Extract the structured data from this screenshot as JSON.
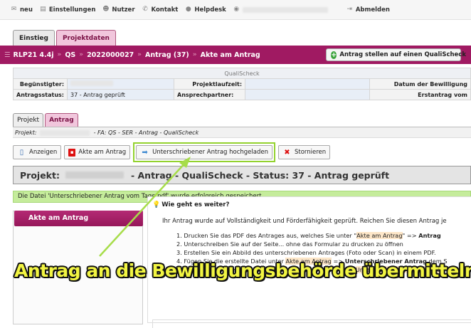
{
  "topbar": {
    "items": [
      {
        "icon": "envelope-icon",
        "label": "neu"
      },
      {
        "icon": "settings-icon",
        "label": "Einstellungen"
      },
      {
        "icon": "users-icon",
        "label": "Nutzer"
      },
      {
        "icon": "phone-icon",
        "label": "Kontakt"
      },
      {
        "icon": "chat-icon",
        "label": "Helpdesk"
      }
    ],
    "logout": "Abmelden"
  },
  "main_tabs": [
    {
      "label": "Einstieg",
      "active": false
    },
    {
      "label": "Projektdaten",
      "active": true
    }
  ],
  "breadcrumb": {
    "program": "RLP21 4.4j",
    "type": "QS",
    "number": "2022000027",
    "antrag": "Antrag (37)",
    "page": "Akte am Antrag",
    "action_button": "Antrag stellen auf einen QualiScheck"
  },
  "info": {
    "header": "QualiScheck",
    "beguenstigter_label": "Begünstigter:",
    "laufzeit_label": "Projektlaufzeit:",
    "bewilligung_label": "Datum der Bewilligung",
    "status_label": "Antragsstatus:",
    "status_value": "37 - Antrag geprüft",
    "partner_label": "Ansprechpartner:",
    "erstantrag_label": "Erstantrag vom"
  },
  "sub_tabs": [
    {
      "label": "Projekt",
      "active": false
    },
    {
      "label": "Antrag",
      "active": true
    }
  ],
  "project_line": {
    "label": "Projekt:",
    "suffix": "- FA: QS - SER - Antrag - QualiScheck"
  },
  "actions": [
    {
      "icon": "book-icon",
      "label": "Anzeigen"
    },
    {
      "icon": "pdf-icon",
      "label": "Akte am Antrag"
    },
    {
      "icon": "upload-arrow-icon",
      "label": "Unterschriebener Antrag hochgeladen"
    },
    {
      "icon": "cross-icon",
      "label": "Stornieren"
    }
  ],
  "status_header": {
    "prefix": "Projekt:",
    "suffix": "- Antrag - QualiScheck - Status: 37 - Antrag geprüft"
  },
  "success_message": "Die Datei 'Unterschriebener Antrag vom Tage.pdf' wurde erfolgreich gespeichert.",
  "left_panel": {
    "button": "Akte am Antrag"
  },
  "help": {
    "title": "Wie geht es weiter?",
    "intro": "Ihr Antrag wurde auf Vollständigkeit und Förderfähigkeit geprüft. Reichen Sie diesen Antrag je",
    "step1_a": "1. Drucken Sie das PDF des Antrages aus, welches Sie unter \"",
    "step1_hl": "Akte am Antrag",
    "step1_b": "\" => ",
    "step1_bold": "Antrag",
    "step2": "2. Unterschreiben Sie auf der Seite... ohne das Formular zu drucken zu öffnen",
    "step3": "3. Erstellen Sie ein Abbild des unterschriebenen Antrages (Foto oder Scan) in einem PDF.",
    "step4_a": "4. Fügen Sie die erstellte Datei unter ",
    "step4_hl": "Akte am Antrag",
    "step4_b": " => ",
    "step4_bold": "Unterschriebener Antrag",
    "step4_c": " dem S",
    "step5_a": "5. Bestätigen Sie den Upload des Antrages mit der Funktion \"",
    "step5_hl": "Unterschriebener Antrag hoc"
  },
  "overlay_caption": "Antrag an die Bewilligungsbehörde übermitteln",
  "colors": {
    "brand": "#a01a62",
    "highlight": "#93d22e",
    "caption": "#f2f542",
    "success": "#c5ec9b"
  }
}
